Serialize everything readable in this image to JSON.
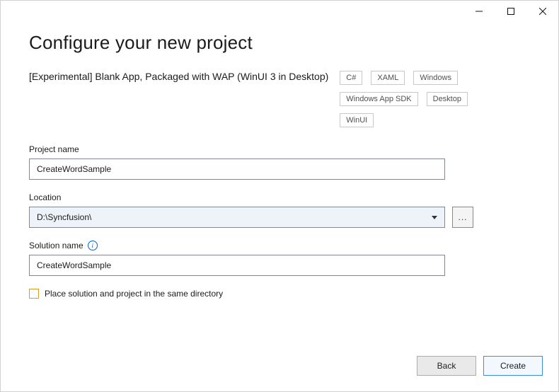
{
  "header": {
    "title": "Configure your new project"
  },
  "template": {
    "name": "[Experimental] Blank App, Packaged with WAP (WinUI 3 in Desktop)",
    "tags": [
      "C#",
      "XAML",
      "Windows",
      "Windows App SDK",
      "Desktop",
      "WinUI"
    ]
  },
  "fields": {
    "project_name_label": "Project name",
    "project_name_value": "CreateWordSample",
    "location_label": "Location",
    "location_value": "D:\\Syncfusion\\",
    "browse_label": "...",
    "solution_name_label": "Solution name",
    "solution_name_value": "CreateWordSample",
    "same_dir_label": "Place solution and project in the same directory",
    "same_dir_checked": false
  },
  "footer": {
    "back_label": "Back",
    "create_label": "Create"
  }
}
